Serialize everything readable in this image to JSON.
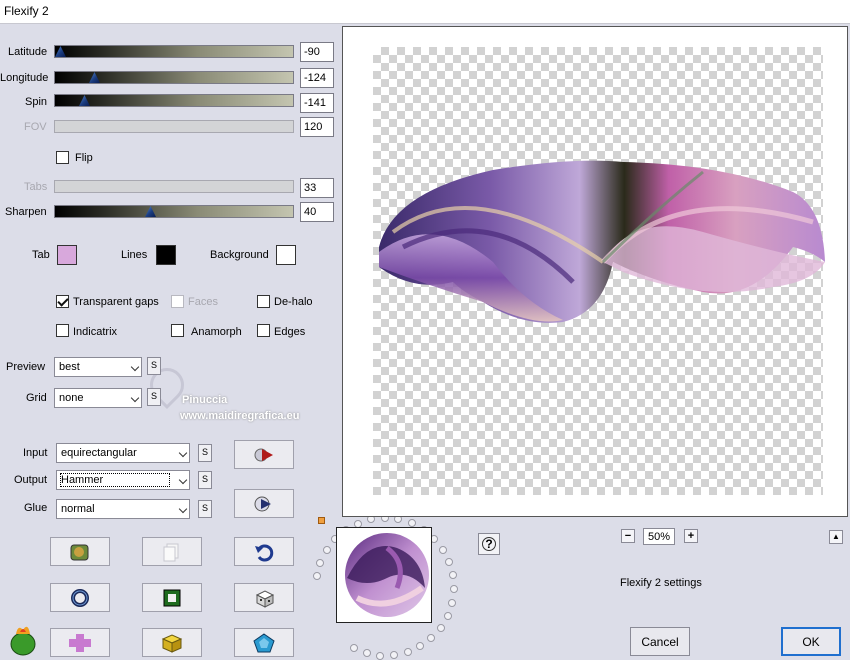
{
  "window": {
    "title": "Flexify 2"
  },
  "sliders": [
    {
      "label": "Latitude",
      "value": "-90",
      "level": 0.0,
      "enabled": true
    },
    {
      "label": "Longitude",
      "value": "-124",
      "level": 0.16,
      "enabled": true
    },
    {
      "label": "Spin",
      "value": "-141",
      "level": 0.11,
      "enabled": true
    },
    {
      "label": "FOV",
      "value": "120",
      "level": 0.0,
      "enabled": false
    },
    {
      "label": "Tabs",
      "value": "33",
      "level": 0.0,
      "enabled": false
    },
    {
      "label": "Sharpen",
      "value": "40",
      "level": 0.4,
      "enabled": true
    }
  ],
  "flip": {
    "label": "Flip",
    "checked": false
  },
  "colors": {
    "tab": {
      "label": "Tab",
      "color": "#d8a8dc"
    },
    "lines": {
      "label": "Lines",
      "color": "#000000"
    },
    "background": {
      "label": "Background",
      "color": "#ffffff"
    }
  },
  "options": {
    "transparent_gaps": {
      "label": "Transparent gaps",
      "checked": true
    },
    "faces": {
      "label": "Faces",
      "checked": false,
      "enabled": false
    },
    "dehalo": {
      "label": "De-halo",
      "checked": false
    },
    "indicatrix": {
      "label": "Indicatrix",
      "checked": false
    },
    "anamorph": {
      "label": "Anamorph",
      "checked": false
    },
    "edges": {
      "label": "Edges",
      "checked": false
    }
  },
  "dropdowns": {
    "preview": {
      "label": "Preview",
      "value": "best"
    },
    "grid": {
      "label": "Grid",
      "value": "none"
    },
    "input": {
      "label": "Input",
      "value": "equirectangular"
    },
    "output": {
      "label": "Output",
      "value": "Hammer"
    },
    "glue": {
      "label": "Glue",
      "value": "normal"
    },
    "s_label": "S"
  },
  "watermark": {
    "line1": "Pinuccia",
    "line2": "www.maidiregrafica.eu"
  },
  "zoom": {
    "minus": "−",
    "value": "50%",
    "plus": "+"
  },
  "help": "?",
  "collapse": "▲",
  "settings_caption": "Flexify 2 settings",
  "buttons": {
    "cancel": "Cancel",
    "ok": "OK"
  }
}
